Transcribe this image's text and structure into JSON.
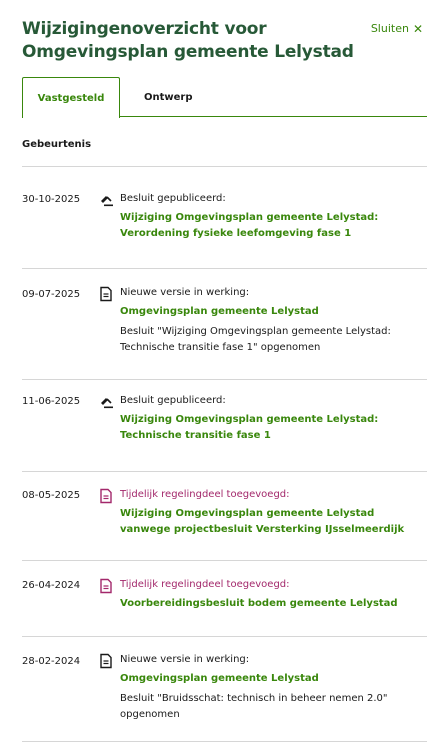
{
  "header": {
    "title": "Wijzigingenoverzicht voor Omgevingsplan gemeente Lelystad",
    "close_label": "Sluiten",
    "close_glyph": "✕"
  },
  "tabs": [
    {
      "label": "Vastgesteld",
      "active": true
    },
    {
      "label": "Ontwerp",
      "active": false
    }
  ],
  "section": {
    "label": "Gebeurtenis"
  },
  "events": [
    {
      "date": "30-10-2025",
      "icon": "gavel-icon",
      "type": "Besluit gepubliceerd:",
      "link": "Wijziging Omgevingsplan gemeente Lelystad: Verordening fysieke leefomgeving fase 1",
      "note": ""
    },
    {
      "date": "09-07-2025",
      "icon": "document-icon",
      "type": "Nieuwe versie in werking:",
      "link": "Omgevingsplan gemeente Lelystad",
      "note": "Besluit \"Wijziging Omgevingsplan gemeente Lelystad: Technische transitie fase 1\" opgenomen"
    },
    {
      "date": "11-06-2025",
      "icon": "gavel-icon",
      "type": "Besluit gepubliceerd:",
      "link": "Wijziging Omgevingsplan gemeente Lelystad: Technische transitie fase 1",
      "note": ""
    },
    {
      "date": "08-05-2025",
      "icon": "document-temporary-icon",
      "type": "Tijdelijk regelingdeel toegevoegd:",
      "link": "Wijziging Omgevingsplan gemeente Lelystad vanwege projectbesluit Versterking IJsselmeerdijk",
      "note": ""
    },
    {
      "date": "26-04-2024",
      "icon": "document-temporary-icon",
      "type": "Tijdelijk regelingdeel toegevoegd:",
      "link": "Voorbereidingsbesluit bodem gemeente Lelystad",
      "note": ""
    },
    {
      "date": "28-02-2024",
      "icon": "document-icon",
      "type": "Nieuwe versie in werking:",
      "link": "Omgevingsplan gemeente Lelystad",
      "note": "Besluit \"Bruidsschat: technisch in beheer nemen 2.0\" opgenomen"
    }
  ],
  "colors": {
    "title": "#275937",
    "accent": "#39870c",
    "temporary": "#a3286b",
    "divider": "#d6d6d6"
  }
}
